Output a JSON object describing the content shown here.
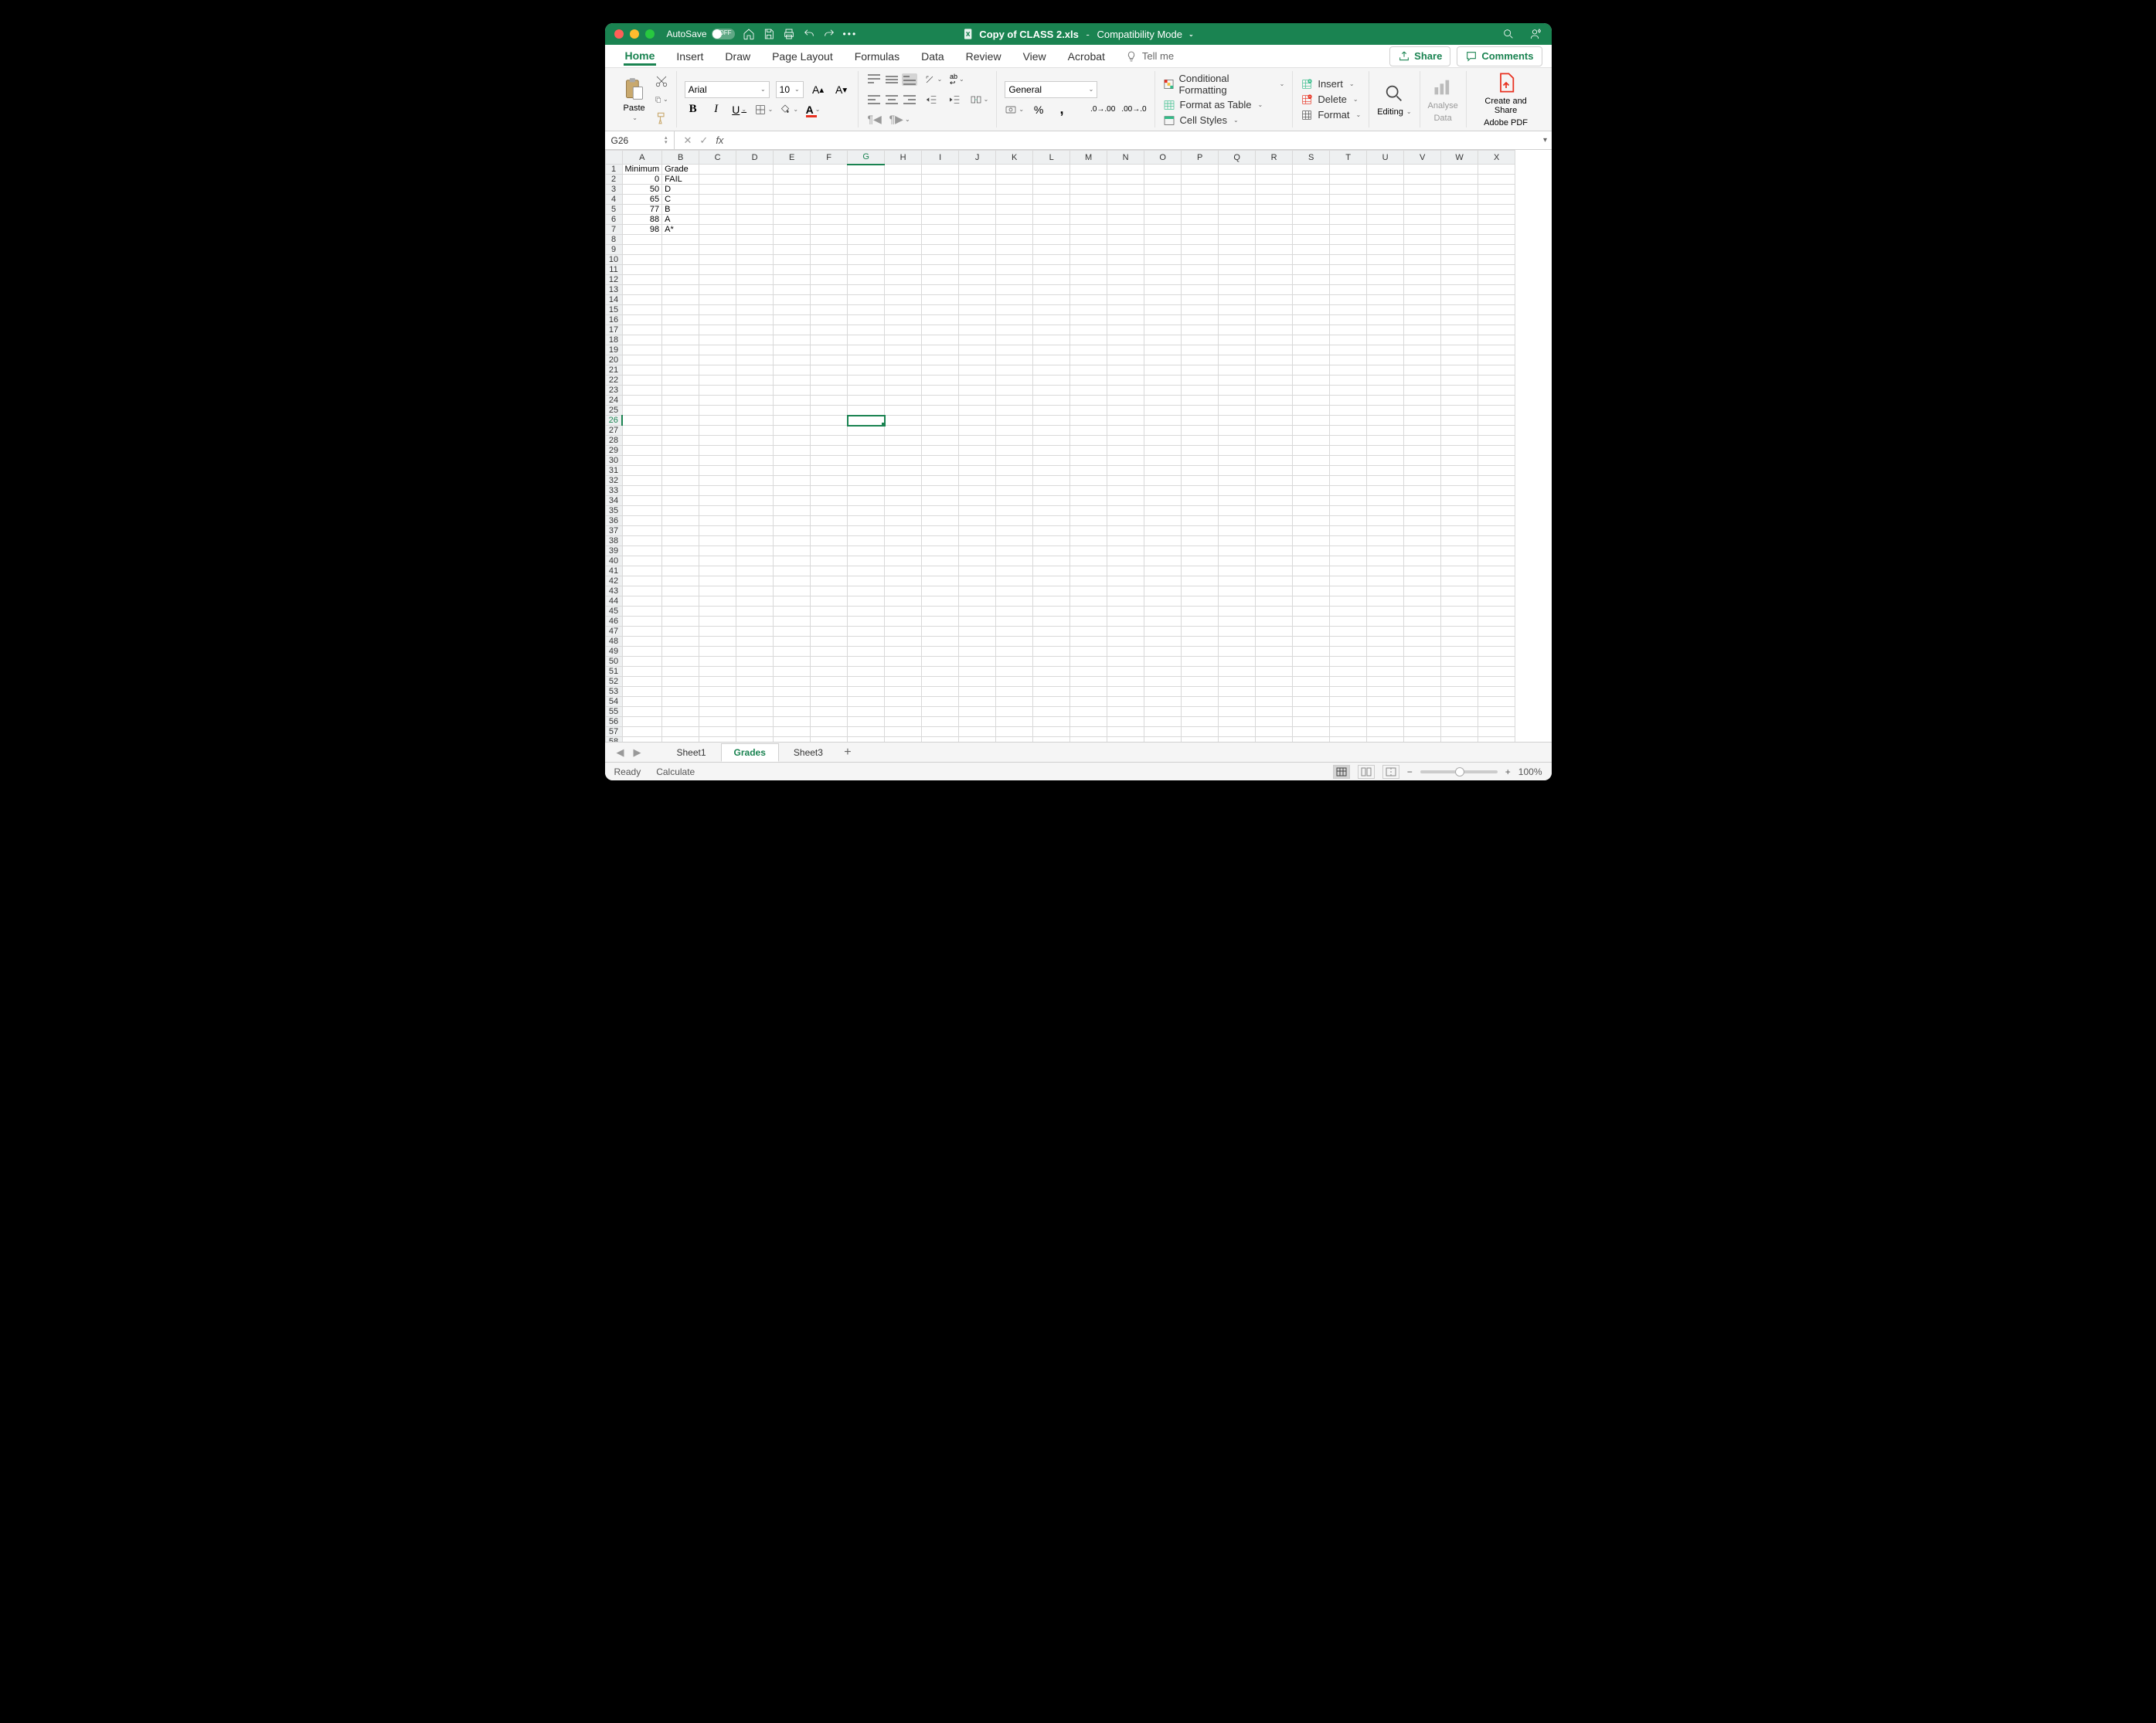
{
  "titlebar": {
    "autosave_label": "AutoSave",
    "autosave_state": "OFF",
    "doc_icon": "excel-doc",
    "filename": "Copy of CLASS 2.xls",
    "mode": "Compatibility Mode"
  },
  "tabs": {
    "items": [
      "Home",
      "Insert",
      "Draw",
      "Page Layout",
      "Formulas",
      "Data",
      "Review",
      "View",
      "Acrobat"
    ],
    "active": "Home",
    "tell_me": "Tell me",
    "share": "Share",
    "comments": "Comments"
  },
  "ribbon": {
    "paste": "Paste",
    "font_name": "Arial",
    "font_size": "10",
    "number_format": "General",
    "cond_fmt": "Conditional Formatting",
    "fmt_table": "Format as Table",
    "cell_styles": "Cell Styles",
    "insert": "Insert",
    "delete": "Delete",
    "format": "Format",
    "editing": "Editing",
    "analyse1": "Analyse",
    "analyse2": "Data",
    "adobe1": "Create and Share",
    "adobe2": "Adobe PDF"
  },
  "formula_bar": {
    "cell_ref": "G26",
    "formula": ""
  },
  "columns": [
    "A",
    "B",
    "C",
    "D",
    "E",
    "F",
    "G",
    "H",
    "I",
    "J",
    "K",
    "L",
    "M",
    "N",
    "O",
    "P",
    "Q",
    "R",
    "S",
    "T",
    "U",
    "V",
    "W",
    "X"
  ],
  "row_count": 59,
  "active_col": "G",
  "active_row": 26,
  "cells": {
    "headers": {
      "A1": "Minimum",
      "B1": "Grade"
    },
    "rows": [
      {
        "A": "0",
        "B": "FAIL"
      },
      {
        "A": "50",
        "B": "D"
      },
      {
        "A": "65",
        "B": "C"
      },
      {
        "A": "77",
        "B": "B"
      },
      {
        "A": "88",
        "B": "A"
      },
      {
        "A": "98",
        "B": "A*"
      }
    ]
  },
  "sheet_tabs": {
    "items": [
      "Sheet1",
      "Grades",
      "Sheet3"
    ],
    "active": "Grades"
  },
  "statusbar": {
    "ready": "Ready",
    "calc": "Calculate",
    "zoom": "100%"
  }
}
